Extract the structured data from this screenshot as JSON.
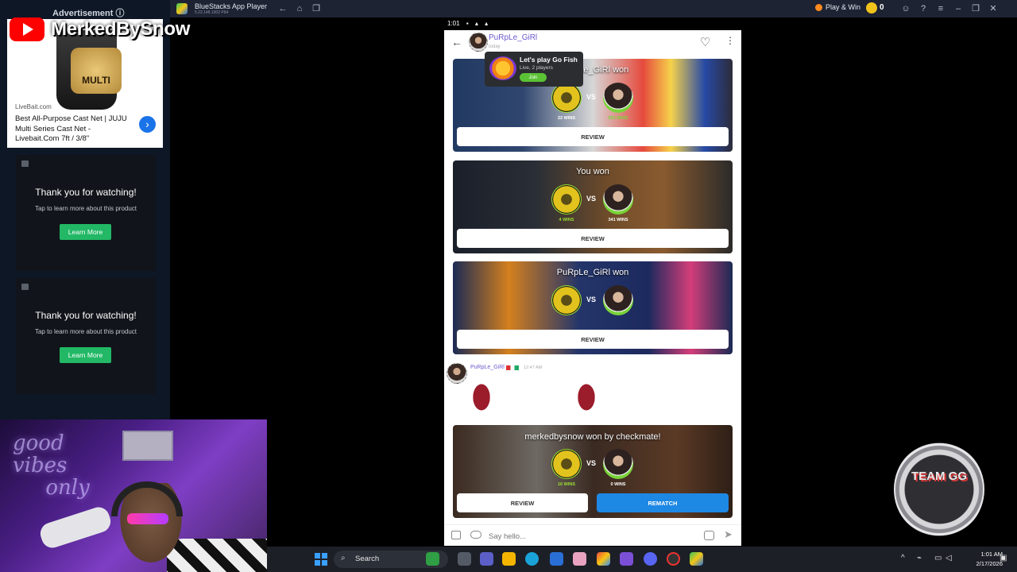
{
  "stream_overlay": {
    "channel_name": "MerkedBySnow",
    "team_badge": "TEAM GG"
  },
  "ad_panel": {
    "header": "Advertisement ⓘ",
    "product_label": "MULTI",
    "source": "LiveBait.com",
    "description": "Best All-Purpose Cast Net | JUJU Multi Series Cast Net - Livebait.Com 7ft / 3/8\"",
    "cards": [
      {
        "title": "Thank you for watching!",
        "subtitle": "Tap to learn more about this product",
        "button": "Learn More"
      },
      {
        "title": "Thank you for watching!",
        "subtitle": "Tap to learn more about this product",
        "button": "Learn More"
      }
    ]
  },
  "window": {
    "title": "BlueStacks App Player",
    "version": "5.22.148.1002  P64",
    "play_win_label": "Play & Win",
    "coins": "0"
  },
  "phone_status": {
    "time": "1:01"
  },
  "chat": {
    "contact_name": "PuRpLe_GiRl",
    "contact_sub": "today",
    "cards": [
      {
        "title": "PuRpLe_GiRl won",
        "vs": "VS",
        "p1_wins": "22 WINS",
        "p2_wins": "932 WINS",
        "review": "REVIEW"
      },
      {
        "title": "You won",
        "vs": "VS",
        "p1_wins": "4 WINS",
        "p2_wins": "341 WINS",
        "review": "REVIEW"
      },
      {
        "title": "PuRpLe_GiRl won",
        "vs": "VS",
        "review": "REVIEW"
      },
      {
        "title": "merkedbysnow won by checkmate!",
        "vs": "VS",
        "p1_wins": "16 WINS",
        "p2_wins": "0 WINS",
        "review": "REVIEW",
        "rematch": "REMATCH"
      }
    ],
    "message": {
      "sender": "PuRpLe_GiRl",
      "time": "12:47 AM",
      "invite_title": "Let's play Go Fish",
      "invite_sub": "Live, 2 players",
      "invite_button": "Join"
    },
    "input_placeholder": "Say hello..."
  },
  "taskbar": {
    "search_label": "Search",
    "time": "1:01 AM",
    "date": "2/17/2026"
  },
  "colors": {
    "accent_blue": "#1e88e5",
    "learn_more_green": "#22b865",
    "username_purple": "#6a5acd"
  }
}
